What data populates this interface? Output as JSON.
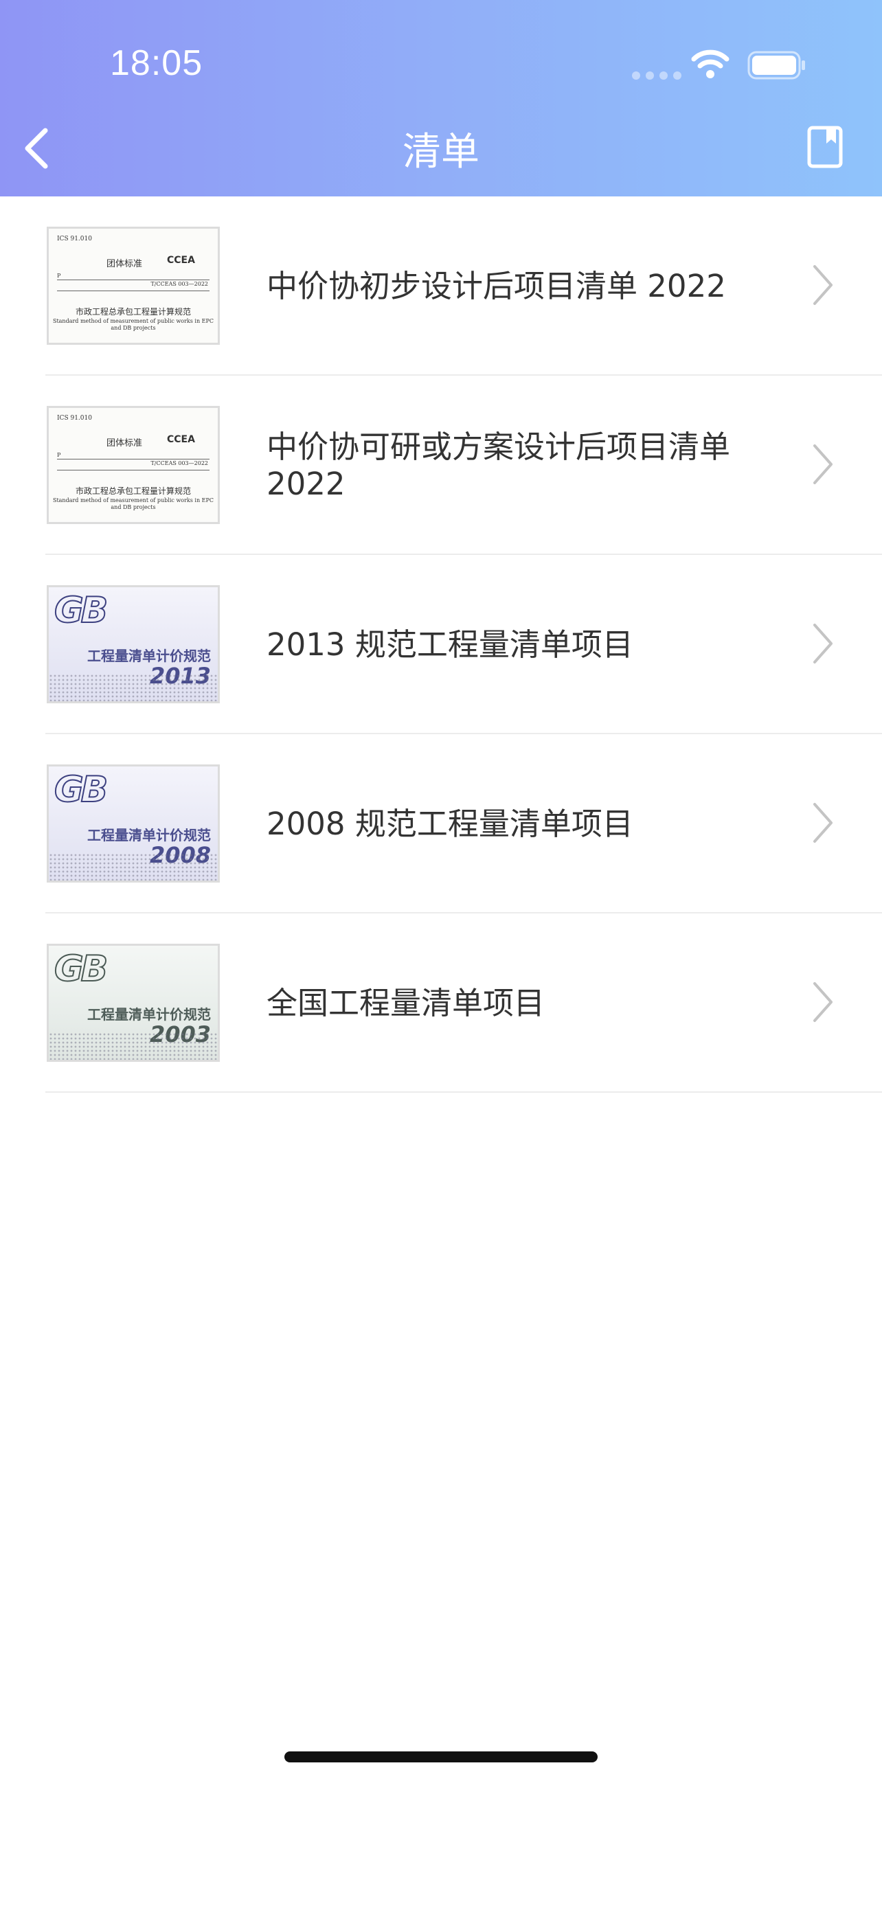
{
  "status_bar": {
    "time": "18:05"
  },
  "nav": {
    "title": "清单"
  },
  "covers": {
    "ccea": {
      "ics": "ICS 91.010",
      "type": "团体标准",
      "logo": "CCEA",
      "p": "P",
      "code": "T/CCEAS 003—2022",
      "name": "市政工程总承包工程量计算规范",
      "en": "Standard method of measurement of public works in EPC and DB projects"
    },
    "gb": {
      "mark": "GB",
      "name": "工程量清单计价规范"
    }
  },
  "items": [
    {
      "label": "中价协初步设计后项目清单 2022",
      "cover": "ccea"
    },
    {
      "label": "中价协可研或方案设计后项目清单 2022",
      "cover": "ccea"
    },
    {
      "label": "2013 规范工程量清单项目",
      "cover": "gb",
      "year": "2013"
    },
    {
      "label": "2008 规范工程量清单项目",
      "cover": "gb",
      "year": "2008"
    },
    {
      "label": "全国工程量清单项目",
      "cover": "gb",
      "year": "2003"
    }
  ],
  "colors": {
    "header_start": "#8f95f5",
    "header_end": "#8fc3fb",
    "text": "#333333",
    "divider": "#ececec"
  },
  "icons": [
    "back-chevron-icon",
    "bookmark-icon",
    "wifi-icon",
    "battery-icon",
    "chevron-right-icon"
  ]
}
